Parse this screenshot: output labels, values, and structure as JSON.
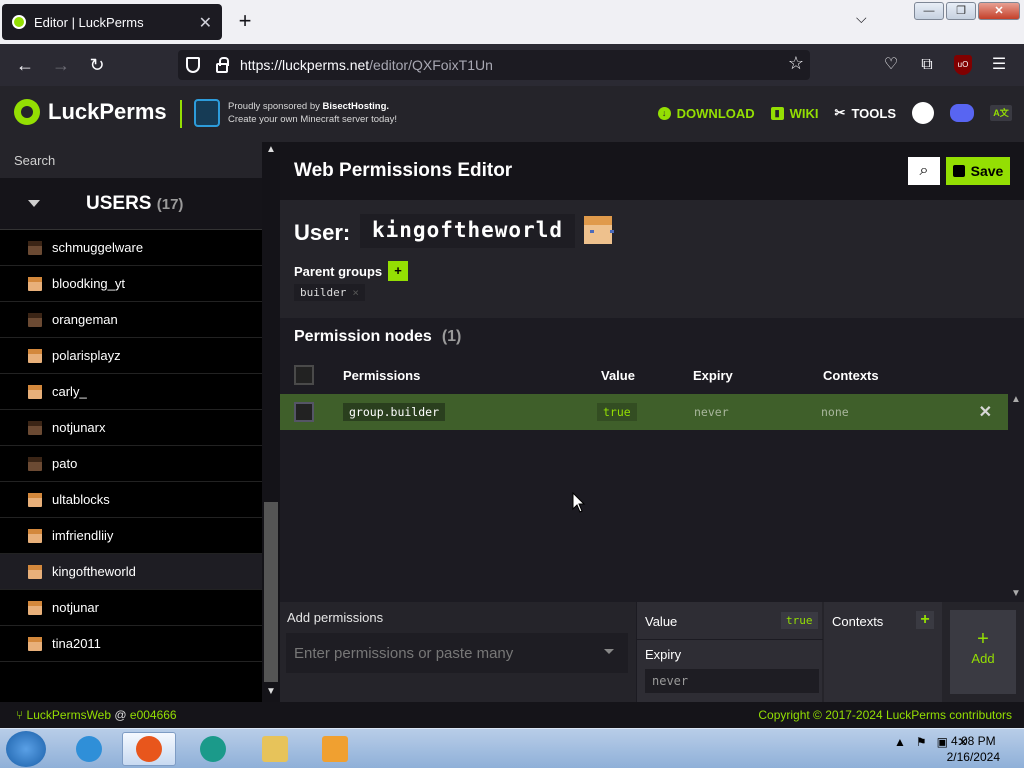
{
  "browser": {
    "tab_title": "Editor | LuckPerms",
    "url_host": "https://luckperms.net",
    "url_path": "/editor/QXFoixT1Un"
  },
  "header": {
    "brand": "LuckPerms",
    "sponsor_line1_prefix": "Proudly sponsored by ",
    "sponsor_name": "BisectHosting.",
    "sponsor_line2": "Create your own Minecraft server today!",
    "links": {
      "download": "DOWNLOAD",
      "wiki": "WIKI",
      "tools": "TOOLS"
    }
  },
  "sidebar": {
    "search_placeholder": "Search",
    "users_label": "USERS",
    "users_count": "(17)",
    "users": [
      {
        "name": "schmuggelware",
        "skin": "brown"
      },
      {
        "name": "bloodking_yt",
        "skin": "tan"
      },
      {
        "name": "orangeman",
        "skin": "brown"
      },
      {
        "name": "polarisplayz",
        "skin": "tan"
      },
      {
        "name": "carly_",
        "skin": "tan"
      },
      {
        "name": "notjunarx",
        "skin": "brown"
      },
      {
        "name": "pato",
        "skin": "brown"
      },
      {
        "name": "ultablocks",
        "skin": "tan"
      },
      {
        "name": "imfriendliiy",
        "skin": "tan"
      },
      {
        "name": "kingoftheworld",
        "skin": "tan",
        "selected": true
      },
      {
        "name": "notjunar",
        "skin": "tan"
      },
      {
        "name": "tina2011",
        "skin": "tan"
      }
    ]
  },
  "main": {
    "title": "Web Permissions Editor",
    "save_label": "Save",
    "user_label": "User:",
    "username": "kingoftheworld",
    "parent_groups_label": "Parent groups",
    "parent_groups_plus": "+",
    "parent_group": "builder",
    "parent_group_remove": "×",
    "nodes_label": "Permission nodes",
    "nodes_count": "(1)",
    "columns": {
      "permissions": "Permissions",
      "value": "Value",
      "expiry": "Expiry",
      "contexts": "Contexts"
    },
    "rows": [
      {
        "permission": "group.builder",
        "value": "true",
        "expiry": "never",
        "contexts": "none"
      }
    ]
  },
  "add": {
    "label": "Add permissions",
    "placeholder": "Enter permissions or paste many",
    "value_label": "Value",
    "value": "true",
    "expiry_label": "Expiry",
    "expiry_value": "never",
    "contexts_label": "Contexts",
    "contexts_plus": "+",
    "add_plus": "+",
    "add_label": "Add"
  },
  "footer": {
    "repo": "LuckPermsWeb",
    "at": " @ ",
    "commit": "e004666",
    "copyright": "Copyright © 2017-2024 LuckPerms contributors"
  },
  "taskbar": {
    "time": "4:08 PM",
    "date": "2/16/2024"
  },
  "colors": {
    "accent": "#94df03",
    "row_bg": "#3f5f2a",
    "bg": "#1c1b22"
  }
}
